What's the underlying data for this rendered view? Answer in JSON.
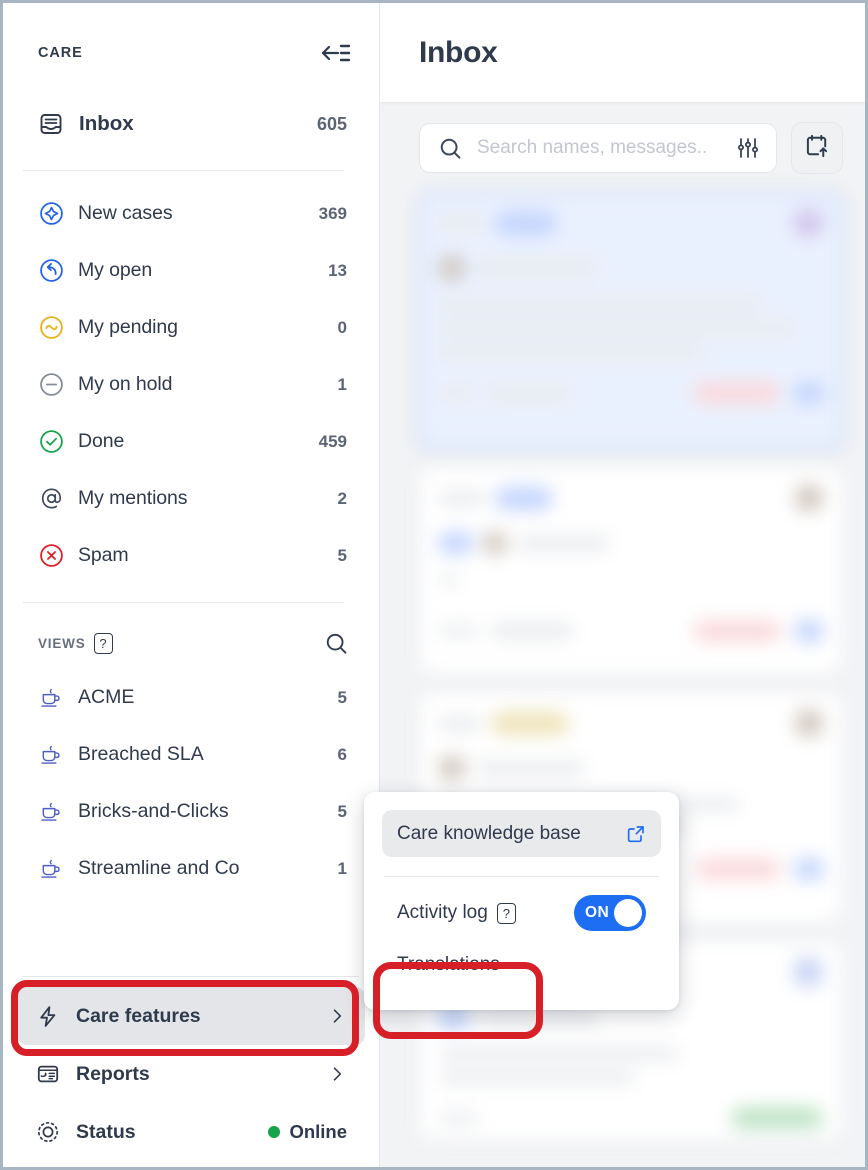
{
  "sidebar": {
    "brand": "CARE",
    "collapse_icon": "collapse-left-icon",
    "inbox": {
      "label": "Inbox",
      "count": "605",
      "icon": "inbox-icon"
    },
    "nav_items": [
      {
        "label": "New cases",
        "count": "369",
        "icon": "new-cases-icon",
        "color": "#2563eb"
      },
      {
        "label": "My open",
        "count": "13",
        "icon": "my-open-icon",
        "color": "#2563eb"
      },
      {
        "label": "My pending",
        "count": "0",
        "icon": "my-pending-icon",
        "color": "#e8b114"
      },
      {
        "label": "My on hold",
        "count": "1",
        "icon": "my-on-hold-icon",
        "color": "#6b7280"
      },
      {
        "label": "Done",
        "count": "459",
        "icon": "done-icon",
        "color": "#16a34a"
      },
      {
        "label": "My mentions",
        "count": "2",
        "icon": "my-mentions-icon",
        "color": "#3c4757"
      },
      {
        "label": "Spam",
        "count": "5",
        "icon": "spam-icon",
        "color": "#e11d28"
      }
    ],
    "views": {
      "title": "VIEWS",
      "help_glyph": "?",
      "search_icon": "search-icon",
      "items": [
        {
          "label": "ACME",
          "count": "5",
          "icon": "view-icon"
        },
        {
          "label": "Breached SLA",
          "count": "6",
          "icon": "view-icon"
        },
        {
          "label": "Bricks-and-Clicks",
          "count": "5",
          "icon": "view-icon"
        },
        {
          "label": "Streamline and Co",
          "count": "1",
          "icon": "view-icon"
        }
      ]
    },
    "bottom": {
      "care_features": {
        "label": "Care features",
        "icon": "lightning-icon",
        "chevron": "chevron-right-icon",
        "active": true
      },
      "reports": {
        "label": "Reports",
        "icon": "reports-icon",
        "chevron": "chevron-right-icon"
      },
      "status": {
        "label": "Status",
        "icon": "status-icon",
        "value": "Online",
        "dot_color": "#16a34a"
      }
    }
  },
  "main": {
    "title": "Inbox",
    "search": {
      "placeholder": "Search names, messages..",
      "value": "",
      "search_icon": "search-icon",
      "filter_icon": "sliders-filter-icon"
    },
    "calendar_button": {
      "icon": "calendar-export-icon"
    },
    "cards": [
      {
        "selected": true
      },
      {
        "selected": false
      },
      {
        "selected": false
      },
      {
        "selected": false
      }
    ]
  },
  "popup": {
    "knowledge_base": {
      "label": "Care knowledge base",
      "icon": "external-link-icon"
    },
    "activity_log": {
      "label": "Activity log",
      "help_glyph": "?",
      "toggle_label": "ON",
      "toggle_on": true
    },
    "translations": {
      "label": "Translations"
    }
  },
  "annotations": {
    "highlight_color": "#d71f27",
    "boxes": [
      "care-features",
      "translations"
    ]
  }
}
